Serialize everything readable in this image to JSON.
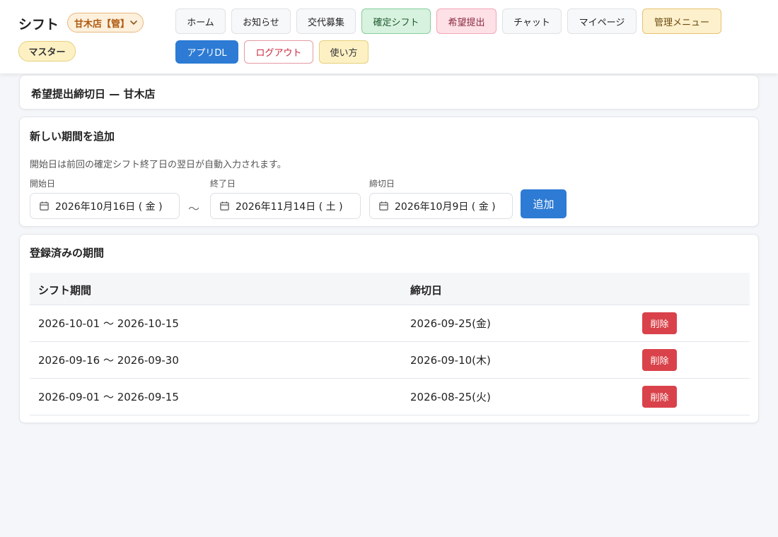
{
  "header": {
    "app_title": "シフト",
    "store_select": "甘木店【管】",
    "role_badge": "マスター",
    "nav": {
      "home": "ホーム",
      "news": "お知らせ",
      "swap": "交代募集",
      "confirmed_shift": "確定シフト",
      "request_submit": "希望提出",
      "chat": "チャット",
      "mypage": "マイページ",
      "admin_menu": "管理メニュー",
      "app_dl": "アプリDL",
      "logout": "ログアウト",
      "howto": "使い方"
    }
  },
  "page_title": "希望提出締切日 — 甘木店",
  "add_period": {
    "title": "新しい期間を追加",
    "help": "開始日は前回の確定シフト終了日の翌日が自動入力されます。",
    "start_label": "開始日",
    "start_value": "2026年10月16日 ( 金 )",
    "separator": "〜",
    "end_label": "終了日",
    "end_value": "2026年11月14日 ( 土 )",
    "deadline_label": "締切日",
    "deadline_value": "2026年10月9日 ( 金 )",
    "add_button": "追加"
  },
  "registered": {
    "title": "登録済みの期間",
    "columns": {
      "period": "シフト期間",
      "deadline": "締切日"
    },
    "delete_label": "削除",
    "rows": [
      {
        "period": "2026-10-01 〜 2026-10-15",
        "deadline": "2026-09-25(金)"
      },
      {
        "period": "2026-09-16 〜 2026-09-30",
        "deadline": "2026-09-10(木)"
      },
      {
        "period": "2026-09-01 〜 2026-09-15",
        "deadline": "2026-08-25(火)"
      }
    ]
  },
  "colors": {
    "primary": "#2d7bd4",
    "danger": "#d9424a",
    "store_badge": "#fdf0dc"
  },
  "icons": [
    "chevron-down-icon",
    "calendar-icon"
  ]
}
